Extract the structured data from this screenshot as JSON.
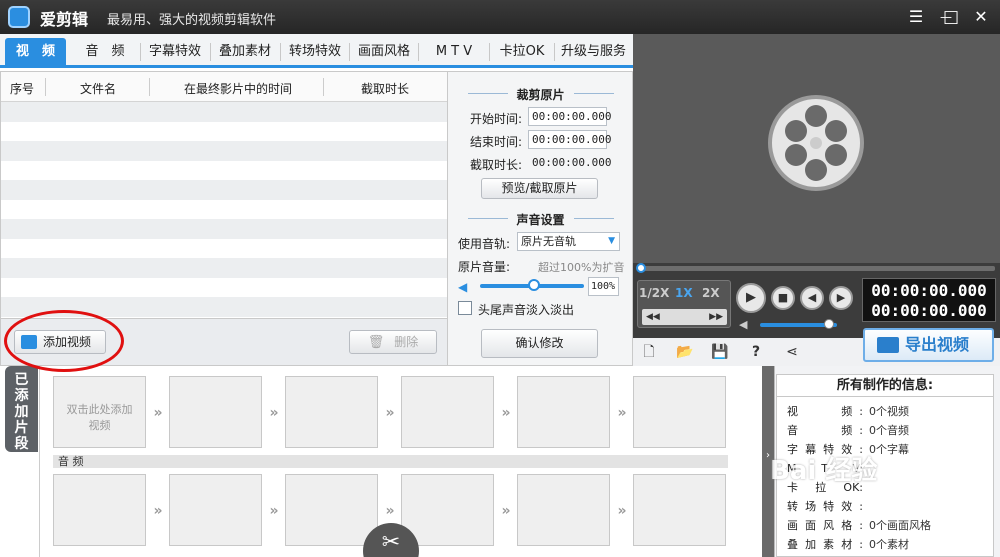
{
  "window": {
    "title": "爱剪辑",
    "subtitle": "最易用、强大的视频剪辑软件",
    "controls": {
      "menu": "☰",
      "minimize": "—",
      "maximize": "□",
      "close": "✕"
    }
  },
  "tabs": [
    "视　频",
    "音　频",
    "字幕特效",
    "叠加素材",
    "转场特效",
    "画面风格",
    "M T V",
    "卡拉OK",
    "升级与服务"
  ],
  "file_list": {
    "columns": [
      "序号",
      "文件名",
      "在最终影片中的时间",
      "截取时长"
    ],
    "add_video_label": "添加视频",
    "delete_label": "删除"
  },
  "trim_panel": {
    "title": "裁剪原片",
    "start_label": "开始时间:",
    "start_value": "00:00:00.000",
    "end_label": "结束时间:",
    "end_value": "00:00:00.000",
    "duration_label": "截取时长:",
    "duration_value": "00:00:00.000",
    "preview_button": "预览/截取原片",
    "sound_title": "声音设置",
    "track_label": "使用音轨:",
    "track_value": "原片无音轨",
    "volume_label": "原片音量:",
    "volume_hint": "超过100%为扩音",
    "volume_value": "100%",
    "fade_label": "头尾声音淡入淡出",
    "confirm_button": "确认修改"
  },
  "player": {
    "speeds": [
      "1/2X",
      "1X",
      "2X"
    ],
    "timecode_current": "00:00:00.000",
    "timecode_total": "00:00:00.000",
    "export_label": "导出视频",
    "progress": 0,
    "volume_level": 0.9
  },
  "timeline": {
    "side_tab": "已添加片段",
    "first_slot_text": "双击此处添加视频",
    "audio_label": "音 频"
  },
  "info_panel": {
    "title": "所有制作的信息:",
    "rows": [
      {
        "key": "视　　频:",
        "value": "0个视频"
      },
      {
        "key": "音　　频:",
        "value": "0个音频"
      },
      {
        "key": "字幕特效:",
        "value": "0个字幕"
      },
      {
        "key": "M　T　V:",
        "value": ""
      },
      {
        "key": "卡 拉 OK:",
        "value": ""
      },
      {
        "key": "转场特效:",
        "value": ""
      },
      {
        "key": "画面风格:",
        "value": "0个画面风格"
      },
      {
        "key": "叠加素材:",
        "value": "0个素材"
      }
    ]
  },
  "watermark": "Bai 经验",
  "colors": {
    "accent": "#2a8ee0",
    "titlebar": "#2e2e2e",
    "annotation": "#e01010"
  }
}
